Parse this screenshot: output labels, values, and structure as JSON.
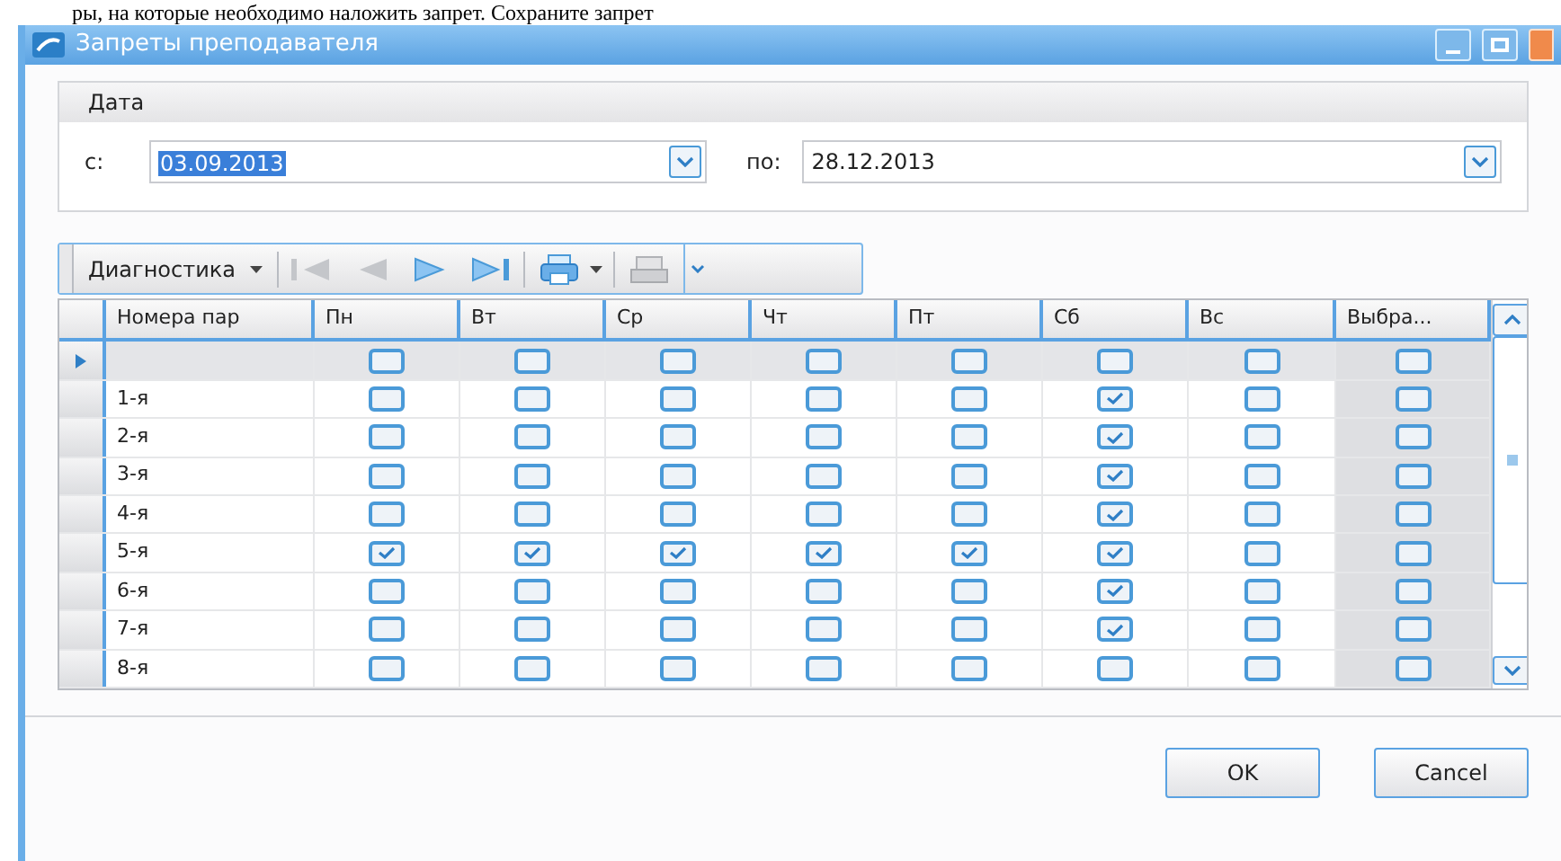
{
  "background_text": "ры, на которые необходимо наложить запрет. Сохраните запрет",
  "window": {
    "title": "Запреты преподавателя"
  },
  "date_group": {
    "title": "Дата",
    "from_label": "с:",
    "from_value": "03.09.2013",
    "to_label": "по:",
    "to_value": "28.12.2013"
  },
  "toolbar": {
    "menu_label": "Диагностика"
  },
  "table": {
    "columns": [
      "Номера пар",
      "Пн",
      "Вт",
      "Ср",
      "Чт",
      "Пт",
      "Сб",
      "Вс",
      "Выбра..."
    ],
    "rows": [
      {
        "label": "",
        "current": true,
        "checks": [
          false,
          false,
          false,
          false,
          false,
          false,
          false,
          false
        ]
      },
      {
        "label": "1-я",
        "current": false,
        "checks": [
          false,
          false,
          false,
          false,
          false,
          true,
          false,
          false
        ]
      },
      {
        "label": "2-я",
        "current": false,
        "checks": [
          false,
          false,
          false,
          false,
          false,
          true,
          false,
          false
        ]
      },
      {
        "label": "3-я",
        "current": false,
        "checks": [
          false,
          false,
          false,
          false,
          false,
          true,
          false,
          false
        ]
      },
      {
        "label": "4-я",
        "current": false,
        "checks": [
          false,
          false,
          false,
          false,
          false,
          true,
          false,
          false
        ]
      },
      {
        "label": "5-я",
        "current": false,
        "checks": [
          true,
          true,
          true,
          true,
          true,
          true,
          false,
          false
        ]
      },
      {
        "label": "6-я",
        "current": false,
        "checks": [
          false,
          false,
          false,
          false,
          false,
          true,
          false,
          false
        ]
      },
      {
        "label": "7-я",
        "current": false,
        "checks": [
          false,
          false,
          false,
          false,
          false,
          true,
          false,
          false
        ]
      },
      {
        "label": "8-я",
        "current": false,
        "checks": [
          false,
          false,
          false,
          false,
          false,
          false,
          false,
          false
        ]
      }
    ]
  },
  "buttons": [
    "OK",
    "Cancel"
  ]
}
